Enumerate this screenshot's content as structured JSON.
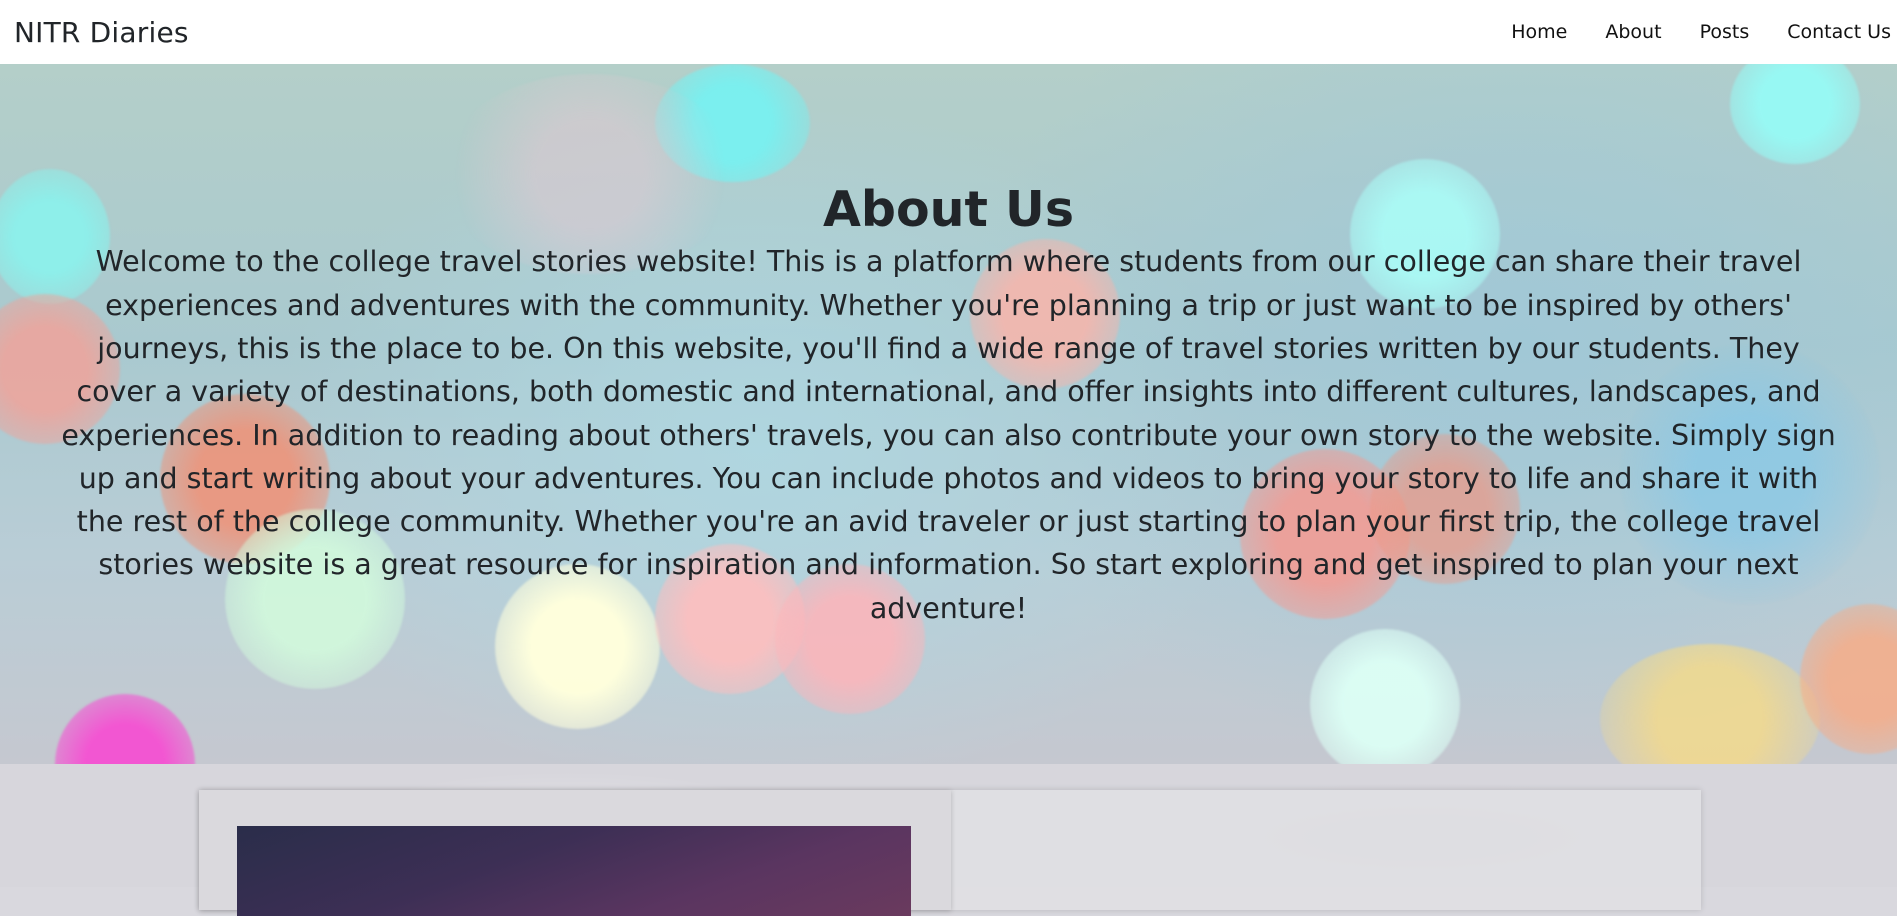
{
  "navbar": {
    "brand": "NITR Diaries",
    "links": [
      "Home",
      "About",
      "Posts",
      "Contact Us"
    ]
  },
  "hero": {
    "title": "About Us",
    "text": "Welcome to the college travel stories website! This is a platform where students from our college can share their travel experiences and adventures with the community. Whether you're planning a trip or just want to be inspired by others' journeys, this is the place to be. On this website, you'll find a wide range of travel stories written by our students. They cover a variety of destinations, both domestic and international, and offer insights into different cultures, landscapes, and experiences. In addition to reading about others' travels, you can also contribute your own story to the website. Simply sign up and start writing about your adventures. You can include photos and videos to bring your story to life and share it with the rest of the college community. Whether you're an avid traveler or just starting to plan your first trip, the college travel stories website is a great resource for inspiration and information. So start exploring and get inspired to plan your next adventure!"
  },
  "colors": {
    "navbar_bg": "#ffffff",
    "text": "#212529",
    "lower_bg": "#d7d6dc"
  }
}
